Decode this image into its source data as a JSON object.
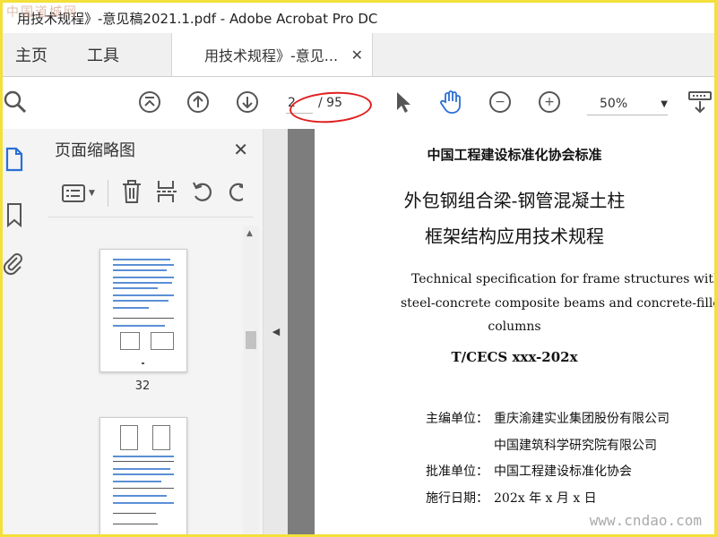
{
  "window": {
    "title": "用技术规程》-意见稿2021.1.pdf - Adobe Acrobat Pro DC"
  },
  "tabs": {
    "home": "主页",
    "tools": "工具",
    "doc": "用技术规程》-意见...",
    "close": "✕"
  },
  "toolbar": {
    "page_current": "2",
    "page_total": "/ 95",
    "zoom": "50%"
  },
  "sidebar": {
    "title": "页面缩略图",
    "close": "✕",
    "thumb1_page": "32"
  },
  "document": {
    "org": "中国工程建设标准化协会标准",
    "title_cn_1": "外包钢组合梁-钢管混凝土柱",
    "title_cn_2": "框架结构应用技术规程",
    "title_en_1": "Technical specification for frame structures with wrappe",
    "title_en_2": "steel-concrete composite beams and concrete-filled steel t",
    "title_en_3": "columns",
    "code": "T/CECS xxx-202x",
    "editor_label": "主编单位：",
    "editor_1": "重庆渝建实业集团股份有限公司",
    "editor_2": "中国建筑科学研究院有限公司",
    "approver_label": "批准单位：",
    "approver": "中国工程建设标准化协会",
    "date_label": "施行日期：",
    "date": "202x 年 x 月 x 日"
  },
  "watermarks": {
    "top_left": "中国道城网",
    "bottom_right": "www.cndao.com"
  },
  "colors": {
    "annotation_red": "#e02020",
    "hand_blue": "#2a6fd6",
    "frame_yellow": "#f3e03a"
  }
}
